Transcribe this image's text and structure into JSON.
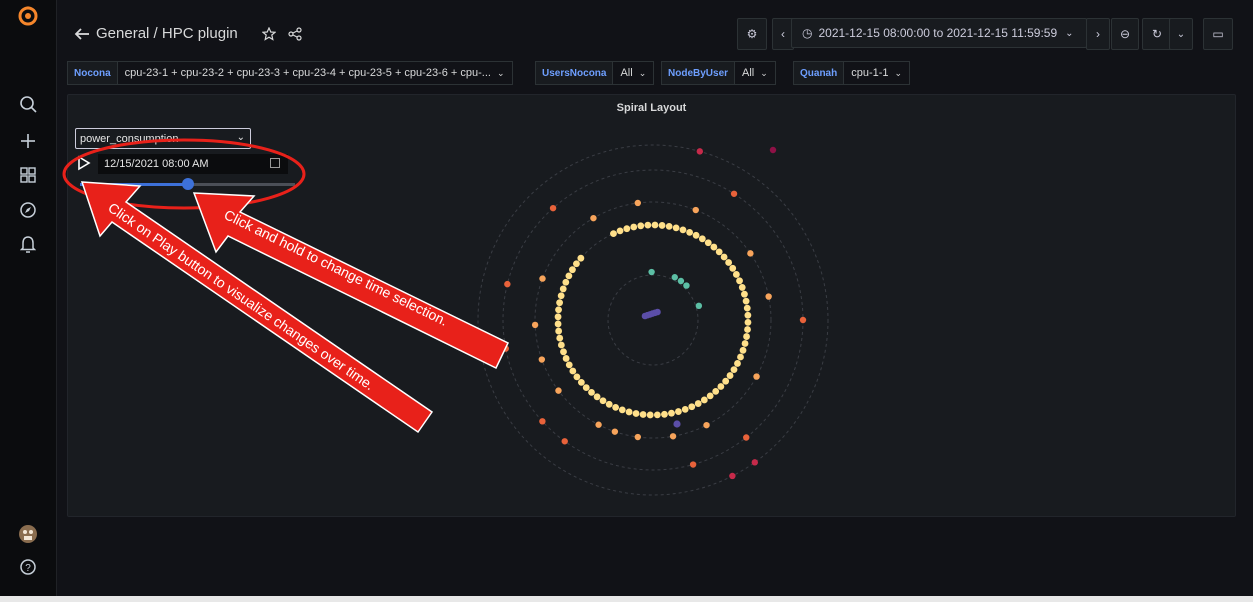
{
  "sidebar": {
    "items": [
      {
        "icon": "grafana-logo-icon"
      },
      {
        "icon": "search-icon"
      },
      {
        "icon": "plus-icon"
      },
      {
        "icon": "dashboards-grid-icon"
      },
      {
        "icon": "explore-compass-icon"
      },
      {
        "icon": "alert-bell-icon"
      },
      {
        "icon": "user-avatar-icon"
      },
      {
        "icon": "help-icon"
      }
    ]
  },
  "header": {
    "breadcrumb": "General / HPC plugin",
    "time_range": "2021-12-15 08:00:00 to 2021-12-15 11:59:59"
  },
  "variables": [
    {
      "label": "Nocona",
      "value": "cpu-23-1 + cpu-23-2 + cpu-23-3 + cpu-23-4 + cpu-23-5 + cpu-23-6 + cpu-..."
    },
    {
      "label": "UsersNocona",
      "value": "All"
    },
    {
      "label": "NodeByUser",
      "value": "All"
    },
    {
      "label": "Quanah",
      "value": "cpu-1-1"
    }
  ],
  "panel": {
    "title": "Spiral Layout",
    "metric_select": "power_consumption",
    "date_value": "12/15/2021 08:00 AM",
    "slider_fraction": 0.5
  },
  "annotations": {
    "play_note": "Click on Play button to visualize changes over time.",
    "hold_note": "Click and hold to change time selection."
  },
  "colors": {
    "accent": "#3d71d9",
    "annotation_red": "#e8211a",
    "dot_palette": [
      "#ffe08a",
      "#f7a45b",
      "#e8623a",
      "#c62a4a",
      "#8e1146",
      "#5cbfa5",
      "#5b4ea8"
    ]
  }
}
